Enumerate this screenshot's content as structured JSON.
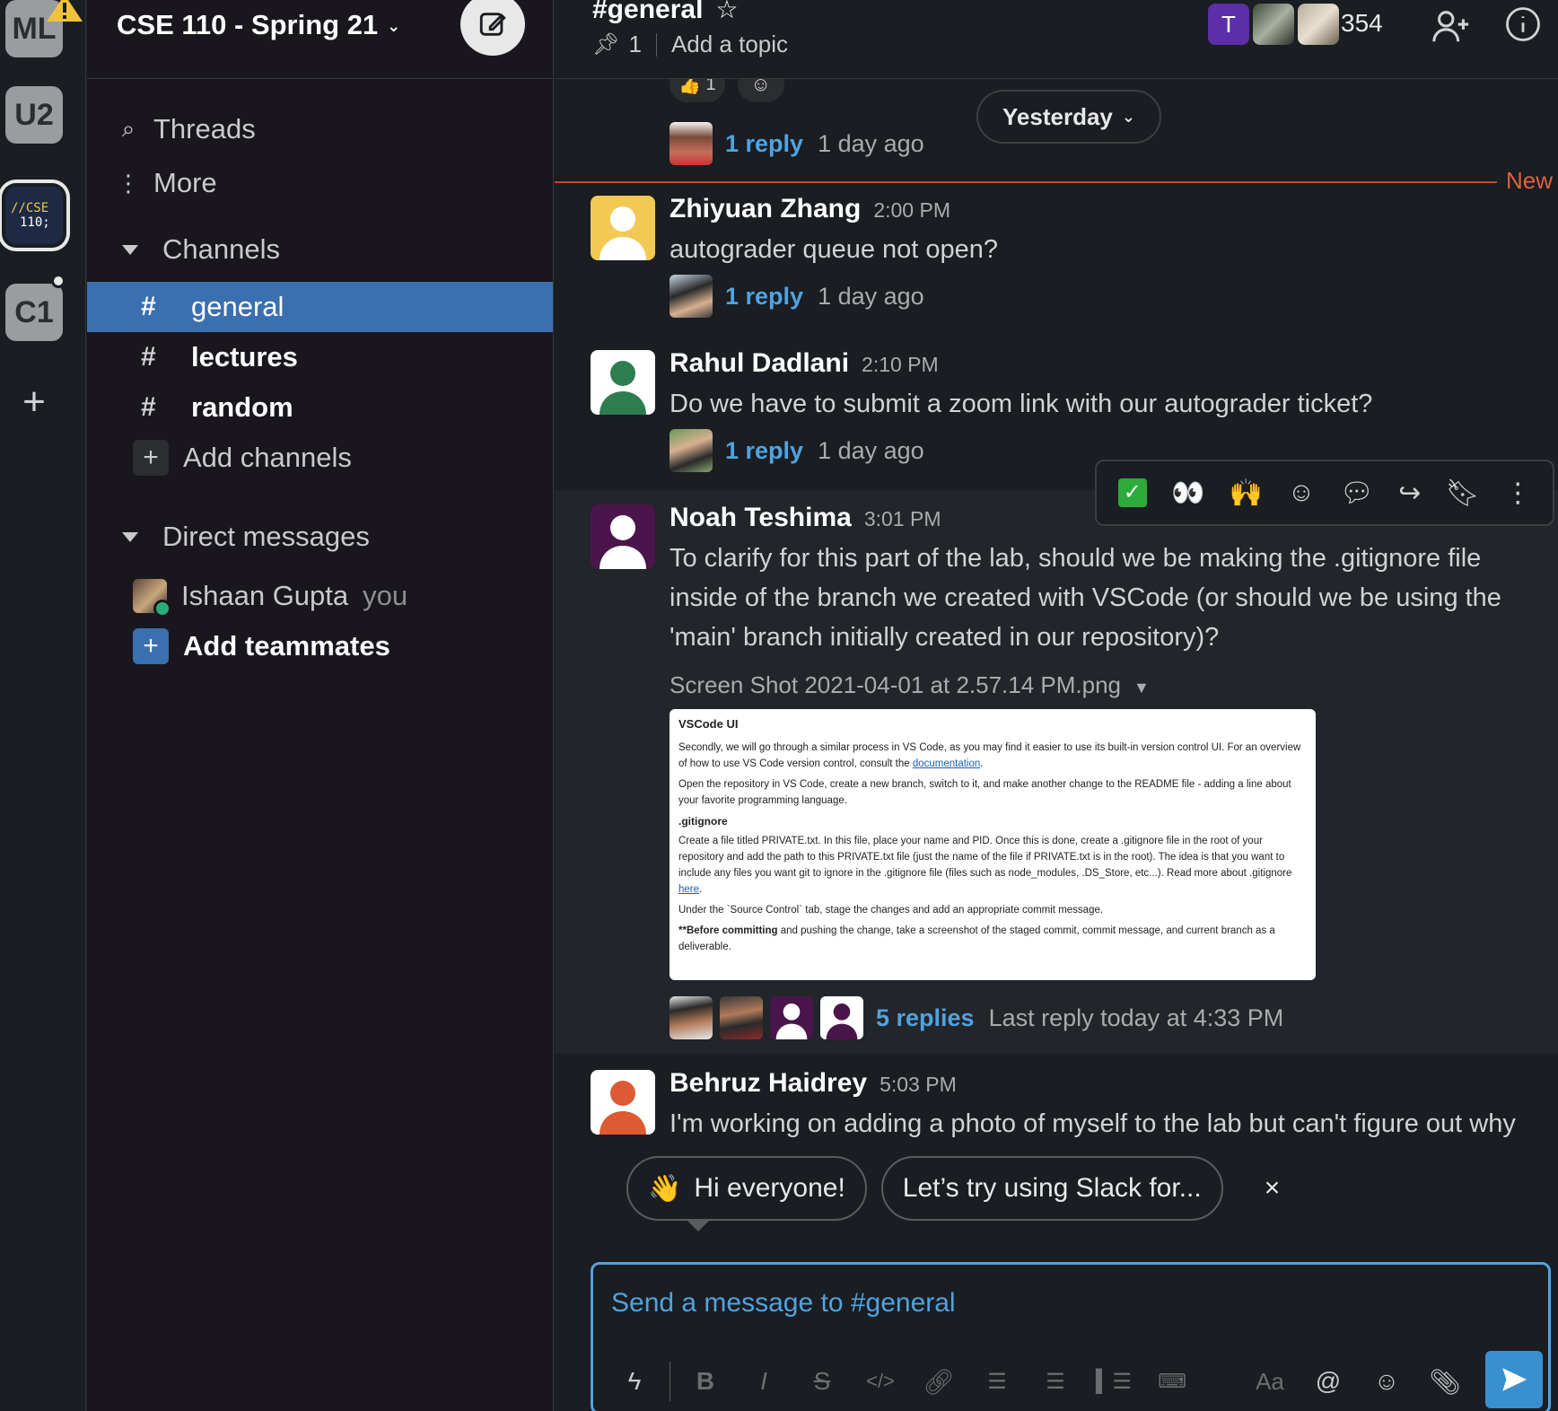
{
  "workspaces": [
    {
      "label": "ML"
    },
    {
      "label": "U2"
    },
    {
      "line1": "//CSE",
      "line2": "110;"
    },
    {
      "label": "C1"
    }
  ],
  "sidebar": {
    "workspace_name": "CSE 110 - Spring 21",
    "threads": "Threads",
    "more": "More",
    "channels_header": "Channels",
    "channels": [
      {
        "name": "general",
        "active": true
      },
      {
        "name": "lectures",
        "unread": true
      },
      {
        "name": "random",
        "unread": true
      }
    ],
    "add_channels": "Add channels",
    "dm_header": "Direct messages",
    "dm_user": "Ishaan Gupta",
    "dm_you": "you",
    "add_teammates": "Add teammates"
  },
  "header": {
    "channel": "#general",
    "pinned_count": "1",
    "topic": "Add a topic",
    "member_initial": "T",
    "member_count": "354"
  },
  "top_reactions": {
    "thumbs_count": "1"
  },
  "date_divider": "Yesterday",
  "new_label": "New",
  "messages": [
    {
      "reply_link": "1 reply",
      "reply_time": "1 day ago"
    },
    {
      "name": "Zhiyuan Zhang",
      "time": "2:00 PM",
      "text": "autograder queue not open?",
      "reply_link": "1 reply",
      "reply_time": "1 day ago"
    },
    {
      "name": "Rahul Dadlani",
      "time": "2:10 PM",
      "text": "Do we have to submit a zoom link with our autograder ticket?",
      "reply_link": "1 reply",
      "reply_time": "1 day ago"
    },
    {
      "name": "Noah Teshima",
      "time": "3:01 PM",
      "text": "To clarify for this part of the lab, should we be making the .gitignore file inside of the branch we created with VSCode (or should we be using the 'main' branch initially created in our repository)?",
      "attachment": "Screen Shot 2021-04-01 at 2.57.14 PM.png",
      "reply_link": "5 replies",
      "reply_time": "Last reply today at 4:33 PM"
    },
    {
      "name": "Behruz Haidrey",
      "time": "5:03 PM",
      "text": "I'm working on adding a photo of myself to the lab but can't figure out why"
    }
  ],
  "attachment_doc": {
    "title": "VSCode UI",
    "p1": "Secondly, we will go through a similar process in VS Code, as you may find it easier to use its built-in version control UI. For an overview of how to use VS Code version control, consult the",
    "p1_link": "documentation",
    "p2": "Open the repository in VS Code, create a new branch, switch to it, and make another change to the README file - adding a line about your favorite programming language.",
    "h2": ".gitignore",
    "p3": "Create a file titled PRIVATE.txt. In this file, place your name and PID. Once this is done, create a .gitignore file in the root of your repository and add the path to this PRIVATE.txt file (just the name of the file if PRIVATE.txt is in the root). The idea is that you want to include any files you want git to ignore in the .gitignore file (files such as node_modules, .DS_Store, etc...). Read more about .gitignore",
    "p3_link": "here",
    "p4": "Under the `Source Control` tab, stage the changes and add an appropriate commit message.",
    "p5_bold": "**Before committing",
    "p5": "and pushing the change, take a screenshot of the staged commit, commit message, and current branch as a deliverable."
  },
  "suggestions": {
    "first": "Hi everyone!",
    "second": "Let’s try using Slack for...",
    "dismiss": "×"
  },
  "composer": {
    "placeholder": "Send a message to #general"
  },
  "colors": {
    "accent": "#3a6fb0",
    "link": "#4fa3e0",
    "new_line": "#c54733"
  }
}
